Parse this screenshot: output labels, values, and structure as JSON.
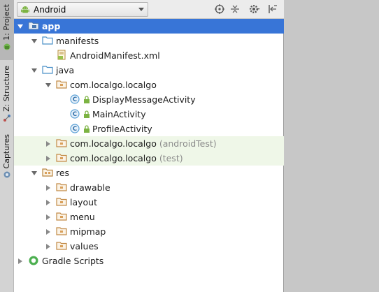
{
  "strip": {
    "tabs": [
      {
        "label": "1: Project",
        "active": true
      },
      {
        "label": "Z: Structure",
        "active": false
      },
      {
        "label": "Captures",
        "active": false
      }
    ]
  },
  "toolbar": {
    "view_mode": "Android",
    "icons": [
      "target-icon",
      "collapse-icon",
      "gear-icon",
      "hide-icon"
    ]
  },
  "tree": {
    "rows": [
      {
        "label": "app",
        "suffix": "",
        "level": 0,
        "expand": "open",
        "icon": "module-folder",
        "selected": true,
        "test": false
      },
      {
        "label": "manifests",
        "suffix": "",
        "level": 1,
        "expand": "open",
        "icon": "folder",
        "selected": false,
        "test": false
      },
      {
        "label": "AndroidManifest.xml",
        "suffix": "",
        "level": 2,
        "expand": "none",
        "icon": "manifest-file",
        "selected": false,
        "test": false
      },
      {
        "label": "java",
        "suffix": "",
        "level": 1,
        "expand": "open",
        "icon": "folder",
        "selected": false,
        "test": false
      },
      {
        "label": "com.localgo.localgo",
        "suffix": "",
        "level": 2,
        "expand": "open",
        "icon": "package",
        "selected": false,
        "test": false
      },
      {
        "label": "DisplayMessageActivity",
        "suffix": "",
        "level": 3,
        "expand": "none",
        "icon": "class",
        "selected": false,
        "test": false
      },
      {
        "label": "MainActivity",
        "suffix": "",
        "level": 3,
        "expand": "none",
        "icon": "class",
        "selected": false,
        "test": false
      },
      {
        "label": "ProfileActivity",
        "suffix": "",
        "level": 3,
        "expand": "none",
        "icon": "class",
        "selected": false,
        "test": false
      },
      {
        "label": "com.localgo.localgo",
        "suffix": "(androidTest)",
        "level": 2,
        "expand": "closed",
        "icon": "package",
        "selected": false,
        "test": true
      },
      {
        "label": "com.localgo.localgo",
        "suffix": "(test)",
        "level": 2,
        "expand": "closed",
        "icon": "package",
        "selected": false,
        "test": true
      },
      {
        "label": "res",
        "suffix": "",
        "level": 1,
        "expand": "open",
        "icon": "res-folder",
        "selected": false,
        "test": false
      },
      {
        "label": "drawable",
        "suffix": "",
        "level": 2,
        "expand": "closed",
        "icon": "package",
        "selected": false,
        "test": false
      },
      {
        "label": "layout",
        "suffix": "",
        "level": 2,
        "expand": "closed",
        "icon": "package",
        "selected": false,
        "test": false
      },
      {
        "label": "menu",
        "suffix": "",
        "level": 2,
        "expand": "closed",
        "icon": "package",
        "selected": false,
        "test": false
      },
      {
        "label": "mipmap",
        "suffix": "",
        "level": 2,
        "expand": "closed",
        "icon": "package",
        "selected": false,
        "test": false
      },
      {
        "label": "values",
        "suffix": "",
        "level": 2,
        "expand": "closed",
        "icon": "package",
        "selected": false,
        "test": false
      },
      {
        "label": "Gradle Scripts",
        "suffix": "",
        "level": 0,
        "expand": "closed",
        "icon": "gradle",
        "selected": false,
        "test": false
      }
    ]
  },
  "colors": {
    "selection": "#3875d7",
    "test_row": "#eff7e8",
    "folder_blue": "#4a90c8",
    "package_orange": "#d9a05b",
    "class_blue": "#5aa1d6"
  }
}
